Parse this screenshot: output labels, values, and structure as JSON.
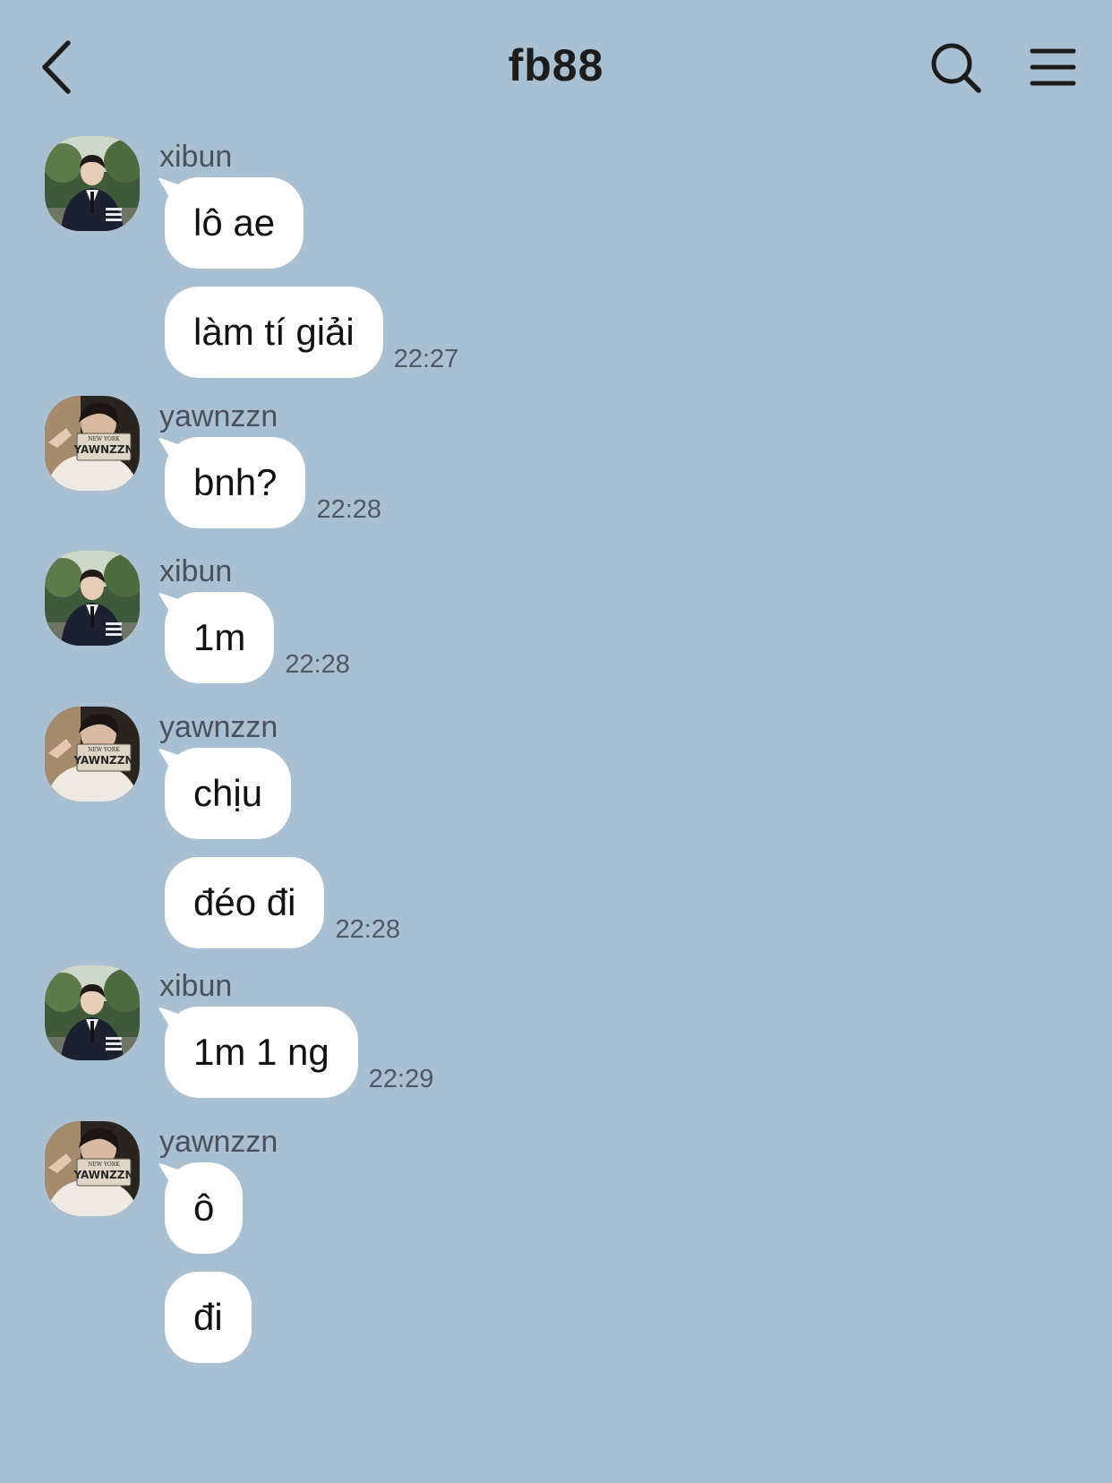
{
  "header": {
    "title": "fb88",
    "back_icon": "chevron-left-icon",
    "search_icon": "search-icon",
    "menu_icon": "hamburger-menu-icon"
  },
  "colors": {
    "background": "#a9bfd2",
    "bubble": "#ffffff",
    "text": "#111111",
    "meta_text": "#4f5964"
  },
  "messages": [
    {
      "sender": "xibun",
      "bubbles": [
        {
          "text": "lô ae",
          "time": ""
        },
        {
          "text": "làm tí giải",
          "time": "22:27"
        }
      ]
    },
    {
      "sender": "yawnzzn",
      "bubbles": [
        {
          "text": "bnh?",
          "time": "22:28"
        }
      ]
    },
    {
      "sender": "xibun",
      "bubbles": [
        {
          "text": "1m",
          "time": "22:28"
        }
      ]
    },
    {
      "sender": "yawnzzn",
      "bubbles": [
        {
          "text": "chịu",
          "time": ""
        },
        {
          "text": "đéo đi",
          "time": "22:28"
        }
      ]
    },
    {
      "sender": "xibun",
      "bubbles": [
        {
          "text": "1m 1 ng",
          "time": "22:29"
        }
      ]
    },
    {
      "sender": "yawnzzn",
      "bubbles": [
        {
          "text": "ô",
          "time": ""
        },
        {
          "text": "đi",
          "time": ""
        }
      ]
    }
  ],
  "avatar_plate_text": {
    "line1": "NEW YORK",
    "line2": "YAWNZZN"
  }
}
